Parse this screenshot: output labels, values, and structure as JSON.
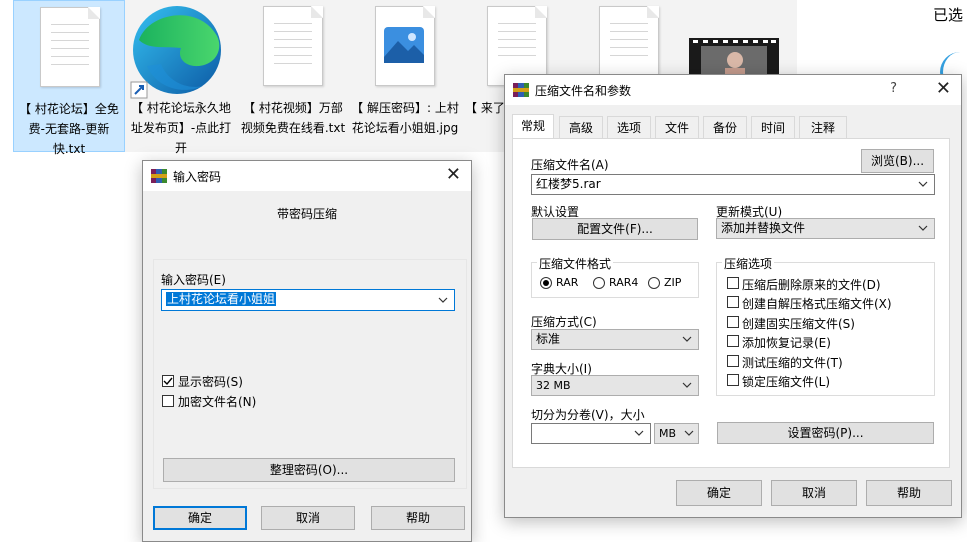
{
  "desktop": {
    "files": [
      {
        "caption": "【 村花论坛】全免费-无套路-更新快.txt",
        "icon": "text-document-icon"
      },
      {
        "caption": "【 村花论坛永久地址发布页】-点此打开",
        "icon": "edge-browser-icon"
      },
      {
        "caption": "【 村花视频】万部视频免费在线看.txt",
        "icon": "text-document-icon"
      },
      {
        "caption": "【 解压密码】: 上村花论坛看小姐姐.jpg",
        "icon": "image-file-icon"
      },
      {
        "caption": "【 来了的论费！",
        "icon": "text-document-icon"
      },
      {
        "caption": "",
        "icon": "text-document-icon"
      },
      {
        "caption": "",
        "icon": "video-file-icon"
      }
    ],
    "selected_label": "已选"
  },
  "password_dialog": {
    "title": "输入密码",
    "subtitle": "带密码压缩",
    "password_label": "输入密码(E)",
    "password_value": "上村花论坛看小姐姐",
    "show_password_label": "显示密码(S)",
    "show_password_checked": true,
    "encrypt_names_label": "加密文件名(N)",
    "encrypt_names_checked": false,
    "organize_button": "整理密码(O)...",
    "ok_button": "确定",
    "cancel_button": "取消",
    "help_button": "帮助"
  },
  "archive_dialog": {
    "title": "压缩文件名和参数",
    "help_glyph": "?",
    "tabs": [
      "常规",
      "高级",
      "选项",
      "文件",
      "备份",
      "时间",
      "注释"
    ],
    "active_tab": "常规",
    "archive_name_label": "压缩文件名(A)",
    "browse_button": "浏览(B)...",
    "archive_name_value": "红楼梦5.rar",
    "default_settings_label": "默认设置",
    "profiles_button": "配置文件(F)...",
    "update_mode_label": "更新模式(U)",
    "update_mode_value": "添加并替换文件",
    "format_group_label": "压缩文件格式",
    "formats": [
      {
        "label": "RAR",
        "selected": true
      },
      {
        "label": "RAR4",
        "selected": false
      },
      {
        "label": "ZIP",
        "selected": false
      }
    ],
    "method_label": "压缩方式(C)",
    "method_value": "标准",
    "dict_label": "字典大小(I)",
    "dict_value": "32 MB",
    "split_label": "切分为分卷(V)，大小",
    "split_value": "",
    "split_unit": "MB",
    "options_group_label": "压缩选项",
    "options": [
      {
        "label": "压缩后删除原来的文件(D)",
        "checked": false
      },
      {
        "label": "创建自解压格式压缩文件(X)",
        "checked": false
      },
      {
        "label": "创建固实压缩文件(S)",
        "checked": false
      },
      {
        "label": "添加恢复记录(E)",
        "checked": false
      },
      {
        "label": "测试压缩的文件(T)",
        "checked": false
      },
      {
        "label": "锁定压缩文件(L)",
        "checked": false
      }
    ],
    "set_password_button": "设置密码(P)...",
    "ok_button": "确定",
    "cancel_button": "取消",
    "help_button": "帮助"
  },
  "colors": {
    "accent": "#0078d7",
    "selection_bg": "#cce8ff",
    "dialog_bg": "#f0f0f0"
  }
}
